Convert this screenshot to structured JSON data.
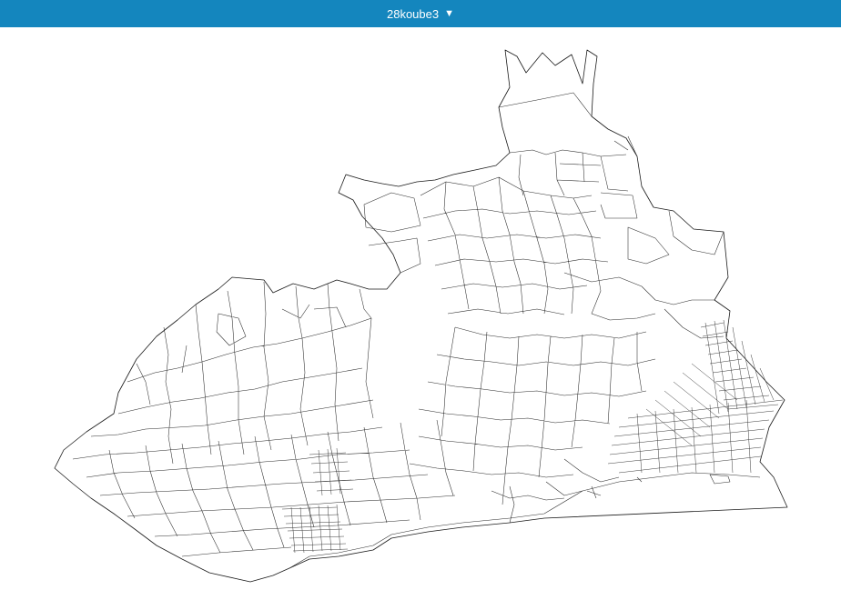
{
  "header": {
    "dataset_name": "28koube3",
    "caret": "▼",
    "background_color": "#1486be",
    "text_color": "#ffffff"
  },
  "map": {
    "stroke_color": "#2a2a2a",
    "fill_color": "#ffffff"
  }
}
